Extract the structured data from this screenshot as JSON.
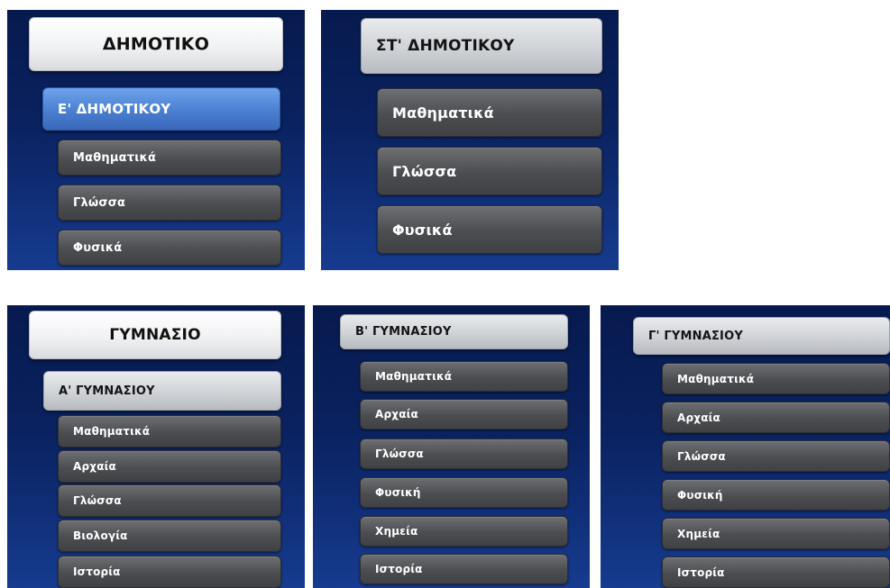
{
  "colors": {
    "panel_bg_top": "#071a4f",
    "panel_bg_bottom": "#163b8f",
    "selected_blue": "#4a7fd2",
    "subject_grey": "#4b4d51"
  },
  "panels": [
    {
      "header": "ΔΗΜΟΤΙΚΟ",
      "class": "Ε' ΔΗΜΟΤΙΚΟΥ",
      "subjects": [
        "Μαθηματικά",
        "Γλώσσα",
        "Φυσικά"
      ]
    },
    {
      "class": "ΣΤ' ΔΗΜΟΤΙΚΟΥ",
      "subjects": [
        "Μαθηματικά",
        "Γλώσσα",
        "Φυσικά"
      ]
    },
    {
      "header": "ΓΥΜΝΑΣΙΟ",
      "class": "Α' ΓΥΜΝΑΣΙΟΥ",
      "subjects": [
        "Μαθηματικά",
        "Αρχαία",
        "Γλώσσα",
        "Βιολογία",
        "Ιστορία"
      ]
    },
    {
      "class": "Β' ΓΥΜΝΑΣΙΟΥ",
      "subjects": [
        "Μαθηματικά",
        "Αρχαία",
        "Γλώσσα",
        "Φυσική",
        "Χημεία",
        "Ιστορία"
      ]
    },
    {
      "class": "Γ' ΓΥΜΝΑΣΙΟΥ",
      "subjects": [
        "Μαθηματικά",
        "Αρχαία",
        "Γλώσσα",
        "Φυσική",
        "Χημεία",
        "Ιστορία"
      ]
    }
  ]
}
